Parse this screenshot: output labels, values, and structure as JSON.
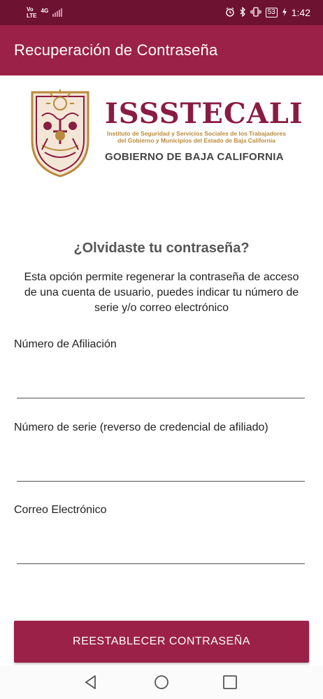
{
  "status_bar": {
    "carrier_top": "Vo",
    "carrier_bottom": "LTE",
    "network": "4G",
    "battery": "53",
    "time": "1:42"
  },
  "app_bar": {
    "title": "Recuperación de Contraseña"
  },
  "logo": {
    "name": "ISSSTECALI",
    "subtitle_line1": "Instituto de Seguridad y Servicios Sociales de los Trabajadores",
    "subtitle_line2": "del Gobierno y Municipios del Estado de Baja California",
    "government": "GOBIERNO DE BAJA CALIFORNIA"
  },
  "form": {
    "heading": "¿Olvidaste tu contraseña?",
    "description": "Esta opción permite regenerar la contraseña de acceso de una cuenta de usuario, puedes indicar tu número de serie y/o correo electrónico",
    "fields": [
      {
        "label": "Número de Afiliación",
        "value": ""
      },
      {
        "label": "Número de serie (reverso de credencial de afiliado)",
        "value": ""
      },
      {
        "label": "Correo Electrónico",
        "value": ""
      }
    ],
    "submit_label": "REESTABLECER CONTRASEÑA"
  },
  "colors": {
    "status_bar": "#6e1232",
    "primary": "#9b2148",
    "brand_text": "#8a1c40",
    "brand_gold": "#b98a3a"
  },
  "nav": {
    "icons": [
      "back-icon",
      "home-icon",
      "recents-icon"
    ]
  }
}
